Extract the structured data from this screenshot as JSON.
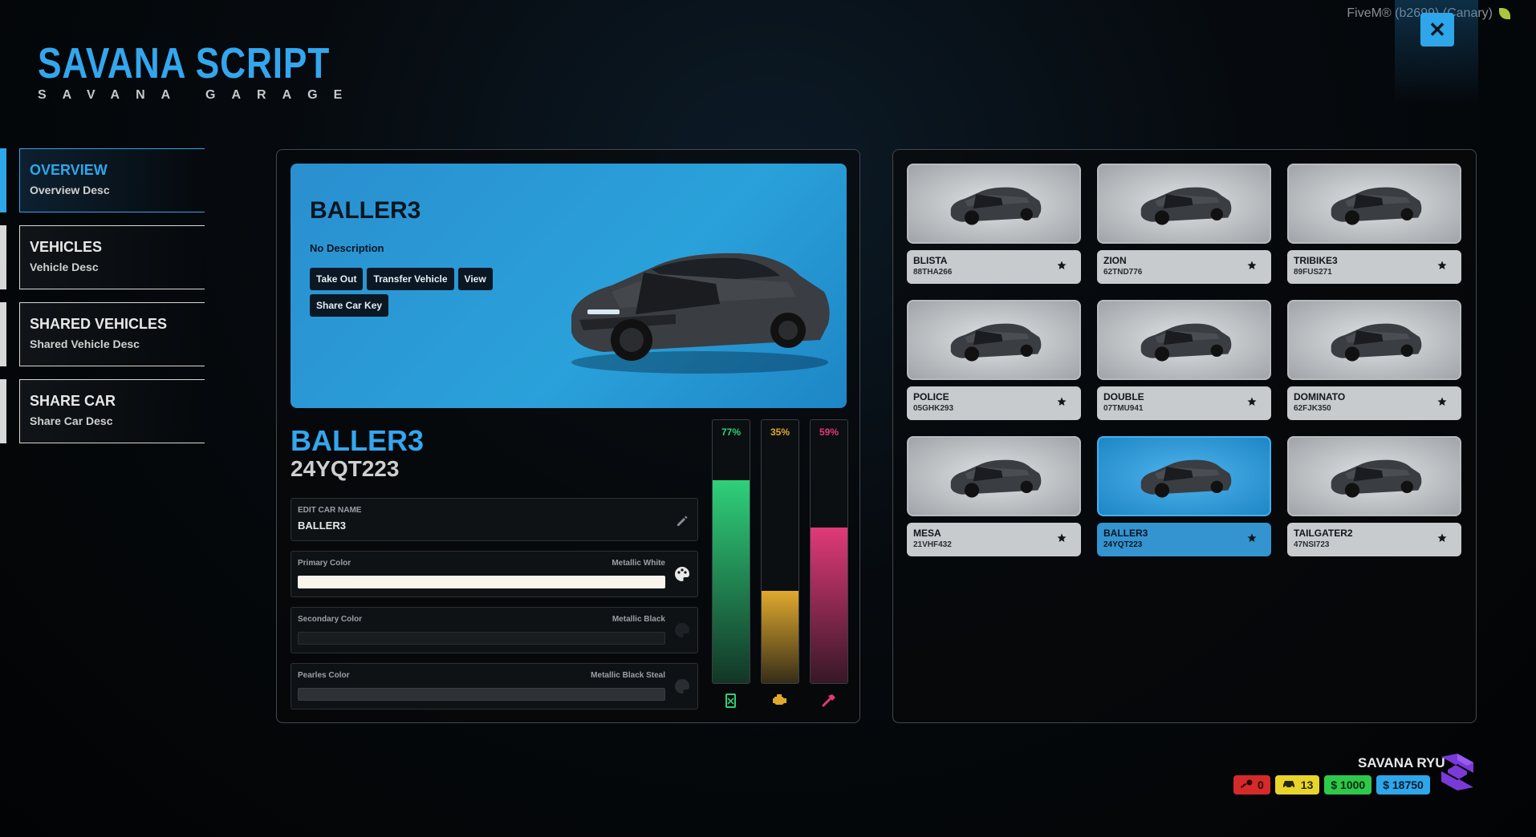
{
  "window": {
    "title": "FiveM® (b2699) (Canary)"
  },
  "brand": {
    "title": "SAVANA SCRIPT",
    "subtitle": "SAVANA GARAGE"
  },
  "nav": [
    {
      "label": "OVERVIEW",
      "desc": "Overview Desc",
      "active": true
    },
    {
      "label": "VEHICLES",
      "desc": "Vehicle Desc",
      "active": false
    },
    {
      "label": "SHARED VEHICLES",
      "desc": "Shared Vehicle Desc",
      "active": false
    },
    {
      "label": "SHARE CAR",
      "desc": "Share Car Desc",
      "active": false
    }
  ],
  "hero": {
    "name": "BALLER3",
    "description": "No Description",
    "buttons": {
      "take_out": "Take Out",
      "transfer": "Transfer Vehicle",
      "view": "View",
      "share_key": "Share Car Key"
    }
  },
  "details": {
    "name": "BALLER3",
    "plate": "24YQT223",
    "edit_name_label": "EDIT CAR NAME",
    "edit_name_value": "BALLER3",
    "primary": {
      "label": "Primary Color",
      "value": "Metallic White",
      "color": "#f8f4ea"
    },
    "secondary": {
      "label": "Secondary Color",
      "value": "Metallic Black",
      "color": "#1a1d20"
    },
    "pearl": {
      "label": "Pearles Color",
      "value": "Metallic Black Steal",
      "color": "#2e3236"
    }
  },
  "gauges": [
    {
      "name": "fuel",
      "value": 77,
      "label": "77%",
      "color": "#2fd07a",
      "icon": "fuel-icon"
    },
    {
      "name": "engine",
      "value": 35,
      "label": "35%",
      "color": "#e0a92e",
      "icon": "engine-icon"
    },
    {
      "name": "body",
      "value": 59,
      "label": "59%",
      "color": "#e03a78",
      "icon": "hammer-icon"
    }
  ],
  "vehicles": [
    {
      "name": "BLISTA",
      "plate": "88THA266",
      "selected": false
    },
    {
      "name": "ZION",
      "plate": "62TND776",
      "selected": false
    },
    {
      "name": "TRIBIKE3",
      "plate": "89FUS271",
      "selected": false
    },
    {
      "name": "POLICE",
      "plate": "05GHK293",
      "selected": false
    },
    {
      "name": "DOUBLE",
      "plate": "07TMU941",
      "selected": false
    },
    {
      "name": "DOMINATO",
      "plate": "62FJK350",
      "selected": false
    },
    {
      "name": "MESA",
      "plate": "21VHF432",
      "selected": false
    },
    {
      "name": "BALLER3",
      "plate": "24YQT223",
      "selected": true
    },
    {
      "name": "TAILGATER2",
      "plate": "47NSI723",
      "selected": false
    }
  ],
  "user": {
    "name": "SAVANA RYU",
    "keys": "0",
    "cars": "13",
    "cash": "$ 1000",
    "bank": "$ 18750"
  }
}
